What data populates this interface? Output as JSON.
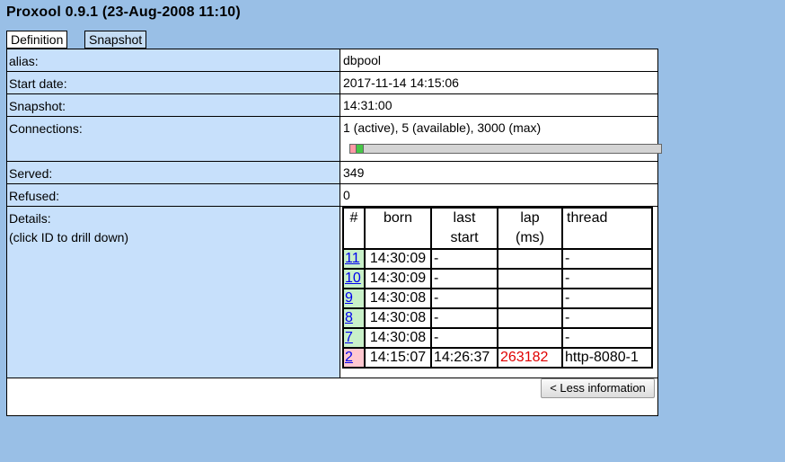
{
  "title": "Proxool 0.9.1 (23-Aug-2008 11:10)",
  "tabs": [
    "Definition",
    "Snapshot"
  ],
  "fields": {
    "alias": {
      "label": "alias:",
      "value": "dbpool"
    },
    "start_date": {
      "label": "Start date:",
      "value": "2017-11-14 14:15:06"
    },
    "snapshot": {
      "label": "Snapshot:",
      "value": "14:31:00"
    },
    "connections": {
      "label": "Connections:",
      "value": "1 (active), 5 (available), 3000 (max)",
      "active": 1,
      "available": 5,
      "max": 3000
    },
    "served": {
      "label": "Served:",
      "value": "349"
    },
    "refused": {
      "label": "Refused:",
      "value": "0"
    },
    "details": {
      "label": "Details:",
      "hint": "(click ID to drill down)"
    }
  },
  "details_table": {
    "headers": {
      "id": "#",
      "born": "born",
      "last_start_1": "last",
      "last_start_2": "start",
      "lap_1": "lap",
      "lap_2": "(ms)",
      "thread": "thread"
    },
    "rows": [
      {
        "id": "11",
        "born": "14:30:09",
        "last_start": "-",
        "lap": "",
        "thread": "-",
        "status": "available"
      },
      {
        "id": "10",
        "born": "14:30:09",
        "last_start": "-",
        "lap": "",
        "thread": "-",
        "status": "available"
      },
      {
        "id": "9",
        "born": "14:30:08",
        "last_start": "-",
        "lap": "",
        "thread": "-",
        "status": "available"
      },
      {
        "id": "8",
        "born": "14:30:08",
        "last_start": "-",
        "lap": "",
        "thread": "-",
        "status": "available"
      },
      {
        "id": "7",
        "born": "14:30:08",
        "last_start": "-",
        "lap": "",
        "thread": "-",
        "status": "available"
      },
      {
        "id": "2",
        "born": "14:15:07",
        "last_start": "14:26:37",
        "lap": "263182",
        "thread": "http-8080-1",
        "status": "active"
      }
    ]
  },
  "less_button": "< Less information",
  "colors": {
    "background": "#99bfe6",
    "label_cell": "#c7e0fb",
    "active": "#ff9aa6",
    "available": "#46c646",
    "lap_highlight": "#e00000"
  }
}
